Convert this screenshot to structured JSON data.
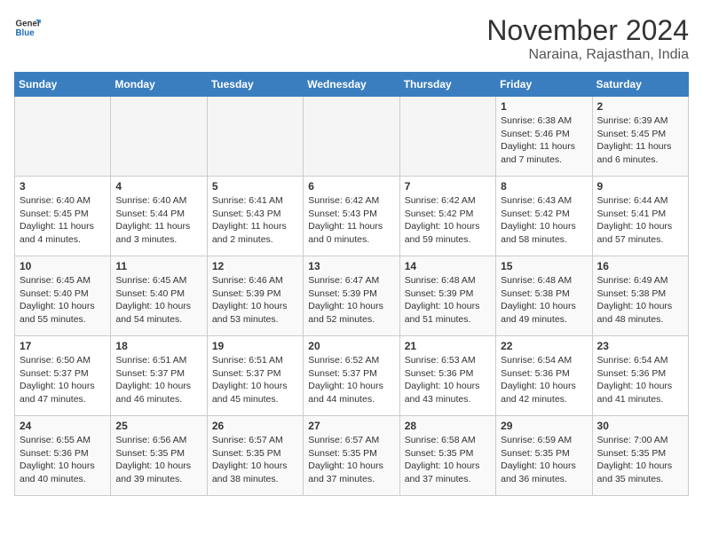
{
  "header": {
    "logo_line1": "General",
    "logo_line2": "Blue",
    "title": "November 2024",
    "subtitle": "Naraina, Rajasthan, India"
  },
  "calendar": {
    "days_of_week": [
      "Sunday",
      "Monday",
      "Tuesday",
      "Wednesday",
      "Thursday",
      "Friday",
      "Saturday"
    ],
    "weeks": [
      [
        {
          "day": "",
          "info": ""
        },
        {
          "day": "",
          "info": ""
        },
        {
          "day": "",
          "info": ""
        },
        {
          "day": "",
          "info": ""
        },
        {
          "day": "",
          "info": ""
        },
        {
          "day": "1",
          "info": "Sunrise: 6:38 AM\nSunset: 5:46 PM\nDaylight: 11 hours and 7 minutes."
        },
        {
          "day": "2",
          "info": "Sunrise: 6:39 AM\nSunset: 5:45 PM\nDaylight: 11 hours and 6 minutes."
        }
      ],
      [
        {
          "day": "3",
          "info": "Sunrise: 6:40 AM\nSunset: 5:45 PM\nDaylight: 11 hours and 4 minutes."
        },
        {
          "day": "4",
          "info": "Sunrise: 6:40 AM\nSunset: 5:44 PM\nDaylight: 11 hours and 3 minutes."
        },
        {
          "day": "5",
          "info": "Sunrise: 6:41 AM\nSunset: 5:43 PM\nDaylight: 11 hours and 2 minutes."
        },
        {
          "day": "6",
          "info": "Sunrise: 6:42 AM\nSunset: 5:43 PM\nDaylight: 11 hours and 0 minutes."
        },
        {
          "day": "7",
          "info": "Sunrise: 6:42 AM\nSunset: 5:42 PM\nDaylight: 10 hours and 59 minutes."
        },
        {
          "day": "8",
          "info": "Sunrise: 6:43 AM\nSunset: 5:42 PM\nDaylight: 10 hours and 58 minutes."
        },
        {
          "day": "9",
          "info": "Sunrise: 6:44 AM\nSunset: 5:41 PM\nDaylight: 10 hours and 57 minutes."
        }
      ],
      [
        {
          "day": "10",
          "info": "Sunrise: 6:45 AM\nSunset: 5:40 PM\nDaylight: 10 hours and 55 minutes."
        },
        {
          "day": "11",
          "info": "Sunrise: 6:45 AM\nSunset: 5:40 PM\nDaylight: 10 hours and 54 minutes."
        },
        {
          "day": "12",
          "info": "Sunrise: 6:46 AM\nSunset: 5:39 PM\nDaylight: 10 hours and 53 minutes."
        },
        {
          "day": "13",
          "info": "Sunrise: 6:47 AM\nSunset: 5:39 PM\nDaylight: 10 hours and 52 minutes."
        },
        {
          "day": "14",
          "info": "Sunrise: 6:48 AM\nSunset: 5:39 PM\nDaylight: 10 hours and 51 minutes."
        },
        {
          "day": "15",
          "info": "Sunrise: 6:48 AM\nSunset: 5:38 PM\nDaylight: 10 hours and 49 minutes."
        },
        {
          "day": "16",
          "info": "Sunrise: 6:49 AM\nSunset: 5:38 PM\nDaylight: 10 hours and 48 minutes."
        }
      ],
      [
        {
          "day": "17",
          "info": "Sunrise: 6:50 AM\nSunset: 5:37 PM\nDaylight: 10 hours and 47 minutes."
        },
        {
          "day": "18",
          "info": "Sunrise: 6:51 AM\nSunset: 5:37 PM\nDaylight: 10 hours and 46 minutes."
        },
        {
          "day": "19",
          "info": "Sunrise: 6:51 AM\nSunset: 5:37 PM\nDaylight: 10 hours and 45 minutes."
        },
        {
          "day": "20",
          "info": "Sunrise: 6:52 AM\nSunset: 5:37 PM\nDaylight: 10 hours and 44 minutes."
        },
        {
          "day": "21",
          "info": "Sunrise: 6:53 AM\nSunset: 5:36 PM\nDaylight: 10 hours and 43 minutes."
        },
        {
          "day": "22",
          "info": "Sunrise: 6:54 AM\nSunset: 5:36 PM\nDaylight: 10 hours and 42 minutes."
        },
        {
          "day": "23",
          "info": "Sunrise: 6:54 AM\nSunset: 5:36 PM\nDaylight: 10 hours and 41 minutes."
        }
      ],
      [
        {
          "day": "24",
          "info": "Sunrise: 6:55 AM\nSunset: 5:36 PM\nDaylight: 10 hours and 40 minutes."
        },
        {
          "day": "25",
          "info": "Sunrise: 6:56 AM\nSunset: 5:35 PM\nDaylight: 10 hours and 39 minutes."
        },
        {
          "day": "26",
          "info": "Sunrise: 6:57 AM\nSunset: 5:35 PM\nDaylight: 10 hours and 38 minutes."
        },
        {
          "day": "27",
          "info": "Sunrise: 6:57 AM\nSunset: 5:35 PM\nDaylight: 10 hours and 37 minutes."
        },
        {
          "day": "28",
          "info": "Sunrise: 6:58 AM\nSunset: 5:35 PM\nDaylight: 10 hours and 37 minutes."
        },
        {
          "day": "29",
          "info": "Sunrise: 6:59 AM\nSunset: 5:35 PM\nDaylight: 10 hours and 36 minutes."
        },
        {
          "day": "30",
          "info": "Sunrise: 7:00 AM\nSunset: 5:35 PM\nDaylight: 10 hours and 35 minutes."
        }
      ]
    ]
  }
}
